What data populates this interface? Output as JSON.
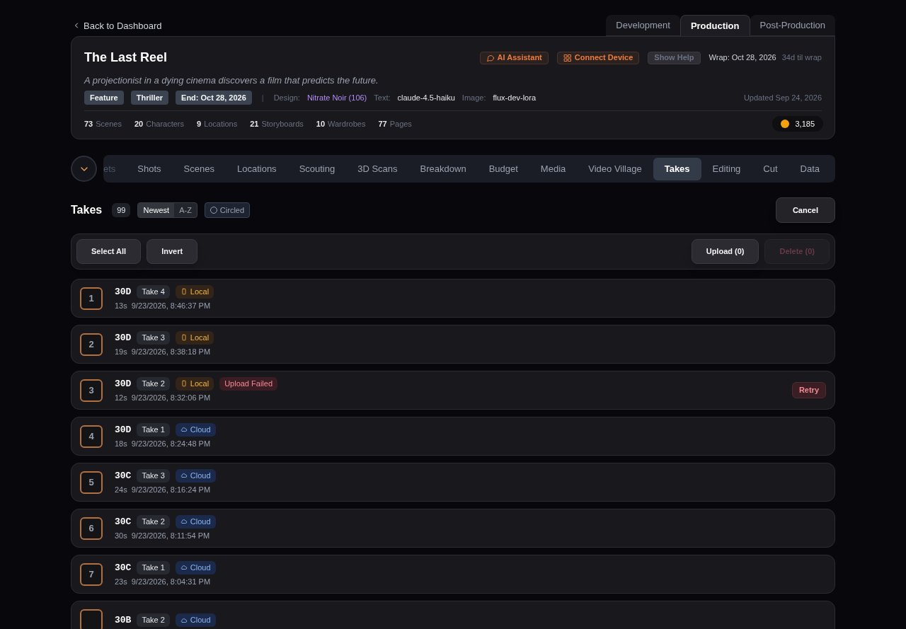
{
  "back_link": "Back to Dashboard",
  "phase_tabs": [
    {
      "label": "Development",
      "selected": false
    },
    {
      "label": "Production",
      "selected": true
    },
    {
      "label": "Post-Production",
      "selected": false
    }
  ],
  "project": {
    "title": "The Last Reel",
    "logline": "A projectionist in a dying cinema discovers a film that predicts the future.",
    "actions": [
      {
        "kind": "assistant",
        "label": "AI Assistant"
      },
      {
        "kind": "device",
        "label": "Connect Device"
      },
      {
        "kind": "help",
        "label": "Show Help"
      }
    ],
    "wrap": "Wrap: Oct 28, 2026",
    "countdown": "34d til wrap",
    "tags": [
      "Feature",
      "Thriller",
      "End: Oct 28, 2026"
    ],
    "separator": "|",
    "meta": [
      {
        "label": "Design:",
        "value": "Nitrate Noir (106)",
        "color": "#b48cf2"
      },
      {
        "label": "Text:",
        "value": "claude-4.5-haiku",
        "color": "#e5e7eb"
      },
      {
        "label": "Image:",
        "value": "flux-dev-lora",
        "color": "#e5e7eb"
      }
    ],
    "updated": "Updated Sep 24, 2026",
    "stats": [
      {
        "count": "73",
        "label": "Scenes"
      },
      {
        "count": "20",
        "label": "Characters"
      },
      {
        "count": "9",
        "label": "Locations"
      },
      {
        "count": "21",
        "label": "Storyboards"
      },
      {
        "count": "10",
        "label": "Wardrobes"
      },
      {
        "count": "77",
        "label": "Pages"
      }
    ],
    "credits": "3,185"
  },
  "nav": {
    "partial": "ets",
    "tabs": [
      {
        "label": "Shots",
        "selected": false
      },
      {
        "label": "Scenes",
        "selected": false
      },
      {
        "label": "Locations",
        "selected": false
      },
      {
        "label": "Scouting",
        "selected": false
      },
      {
        "label": "3D Scans",
        "selected": false
      },
      {
        "label": "Breakdown",
        "selected": false
      },
      {
        "label": "Budget",
        "selected": false
      },
      {
        "label": "Media",
        "selected": false
      },
      {
        "label": "Video Village",
        "selected": false
      },
      {
        "label": "Takes",
        "selected": true
      },
      {
        "label": "Editing",
        "selected": false
      },
      {
        "label": "Cut",
        "selected": false
      },
      {
        "label": "Data",
        "selected": false
      }
    ]
  },
  "takes_header": {
    "title": "Takes",
    "count": "99",
    "sort": [
      {
        "label": "Newest",
        "selected": true
      },
      {
        "label": "A-Z",
        "selected": false
      }
    ],
    "filter": {
      "label": "Circled",
      "checked": false
    },
    "cancel": "Cancel"
  },
  "toolbar": {
    "left": [
      {
        "label": "Select All",
        "disabled": false
      },
      {
        "label": "Invert",
        "disabled": false
      }
    ],
    "right": [
      {
        "label": "Upload (0)",
        "disabled": false
      },
      {
        "label": "Delete (0)",
        "disabled": true
      }
    ]
  },
  "takes": [
    {
      "number": "1",
      "scene": "30D",
      "take": "Take 4",
      "storage": {
        "kind": "local",
        "label": "Local"
      },
      "duration": "13s",
      "time": "9/23/2026, 8:46:37 PM"
    },
    {
      "number": "2",
      "scene": "30D",
      "take": "Take 3",
      "storage": {
        "kind": "local",
        "label": "Local"
      },
      "duration": "19s",
      "time": "9/23/2026, 8:38:18 PM"
    },
    {
      "number": "3",
      "scene": "30D",
      "take": "Take 2",
      "storage": {
        "kind": "local",
        "label": "Local"
      },
      "error": "Upload Failed",
      "action": "Retry",
      "duration": "12s",
      "time": "9/23/2026, 8:32:06 PM"
    },
    {
      "number": "4",
      "scene": "30D",
      "take": "Take 1",
      "storage": {
        "kind": "cloud",
        "label": "Cloud"
      },
      "duration": "18s",
      "time": "9/23/2026, 8:24:48 PM"
    },
    {
      "number": "5",
      "scene": "30C",
      "take": "Take 3",
      "storage": {
        "kind": "cloud",
        "label": "Cloud"
      },
      "duration": "24s",
      "time": "9/23/2026, 8:16:24 PM"
    },
    {
      "number": "6",
      "scene": "30C",
      "take": "Take 2",
      "storage": {
        "kind": "cloud",
        "label": "Cloud"
      },
      "duration": "30s",
      "time": "9/23/2026, 8:11:54 PM"
    },
    {
      "number": "7",
      "scene": "30C",
      "take": "Take 1",
      "storage": {
        "kind": "cloud",
        "label": "Cloud"
      },
      "duration": "23s",
      "time": "9/23/2026, 8:04:31 PM"
    },
    {
      "scene": "30B",
      "take": "Take 2",
      "storage": {
        "kind": "cloud",
        "label": "Cloud"
      }
    }
  ]
}
